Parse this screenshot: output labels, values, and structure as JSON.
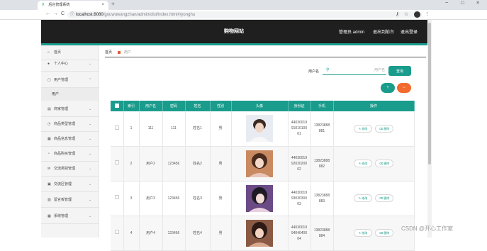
{
  "browser": {
    "tab_title": "后台管理系统",
    "tab_close": "×",
    "new_tab": "+",
    "win_min": "−",
    "win_max": "□",
    "win_close": "×",
    "nav_back": "←",
    "nav_forward": "→",
    "nav_reload": "C",
    "url_host": "localhost:8080",
    "url_path": "/gouwuwangzhan/admin/dist/index.html#/yonghu",
    "lock_icon": "ⓘ",
    "key_icon": "⚷",
    "star_icon": "☆",
    "menu_icon": "⋮"
  },
  "appbar": {
    "title": "购物网站",
    "admin": "管理员 admin",
    "exit_front": "退出到前台",
    "logout": "退出登录"
  },
  "sidebar": {
    "items": [
      {
        "label": "首页",
        "icon": "⌂",
        "chev": ""
      },
      {
        "label": "个人中心",
        "icon": "●",
        "chev": "⌄"
      },
      {
        "label": "用户管理",
        "icon": "▢",
        "chev": "⌃"
      },
      {
        "label": "商家管理",
        "icon": "▤",
        "chev": "⌄"
      },
      {
        "label": "商品类型管理",
        "icon": "◷",
        "chev": "⌄"
      },
      {
        "label": "商品信息管理",
        "icon": "▦",
        "chev": "⌄"
      },
      {
        "label": "商品购买管理",
        "icon": "◔",
        "chev": "⌄"
      },
      {
        "label": "交流类别管理",
        "icon": "✉",
        "chev": "⌄"
      },
      {
        "label": "交流区管理",
        "icon": "▣",
        "chev": "⌄"
      },
      {
        "label": "留言板管理",
        "icon": "▥",
        "chev": "⌄"
      },
      {
        "label": "系统管理",
        "icon": "▦",
        "chev": "⌄"
      }
    ],
    "sub_user": "用户"
  },
  "breadcrumb": {
    "home": "首页",
    "current": "用户"
  },
  "search": {
    "label": "用户名",
    "placeholder": "用户名",
    "button": "查询",
    "icon": "⚲"
  },
  "actions": {
    "add": "+",
    "delete": "−"
  },
  "table": {
    "headers": [
      "",
      "索引",
      "用户名",
      "密码",
      "姓名",
      "性别",
      "头像",
      "身份证",
      "手机",
      "操作"
    ],
    "edit_label": "✎ 修改",
    "delete_label": "⌫ 删除",
    "rows": [
      {
        "index": "1",
        "username": "111",
        "password": "111",
        "name": "姓名1",
        "gender": "男",
        "idcard_l1": "44030019",
        "idcard_l2": "91010100",
        "idcard_l3": "01",
        "phone_l1": "13823888",
        "phone_l2": "881"
      },
      {
        "index": "2",
        "username": "用户2",
        "password": "123456",
        "name": "姓名2",
        "gender": "男",
        "idcard_l1": "44030019",
        "idcard_l2": "92020200",
        "idcard_l3": "02",
        "phone_l1": "13823888",
        "phone_l2": "882"
      },
      {
        "index": "3",
        "username": "用户3",
        "password": "123456",
        "name": "姓名3",
        "gender": "男",
        "idcard_l1": "44030019",
        "idcard_l2": "93030300",
        "idcard_l3": "03",
        "phone_l1": "13823888",
        "phone_l2": "883"
      },
      {
        "index": "4",
        "username": "用户4",
        "password": "123456",
        "name": "姓名4",
        "gender": "男",
        "idcard_l1": "44030019",
        "idcard_l2": "94040400",
        "idcard_l3": "04",
        "phone_l1": "13823888",
        "phone_l2": "884"
      }
    ]
  },
  "watermark": "CSDN @开心工作室",
  "colors": {
    "accent": "#1a9c8c",
    "danger": "#f26a2e",
    "header_bg": "#1f1f1f"
  }
}
